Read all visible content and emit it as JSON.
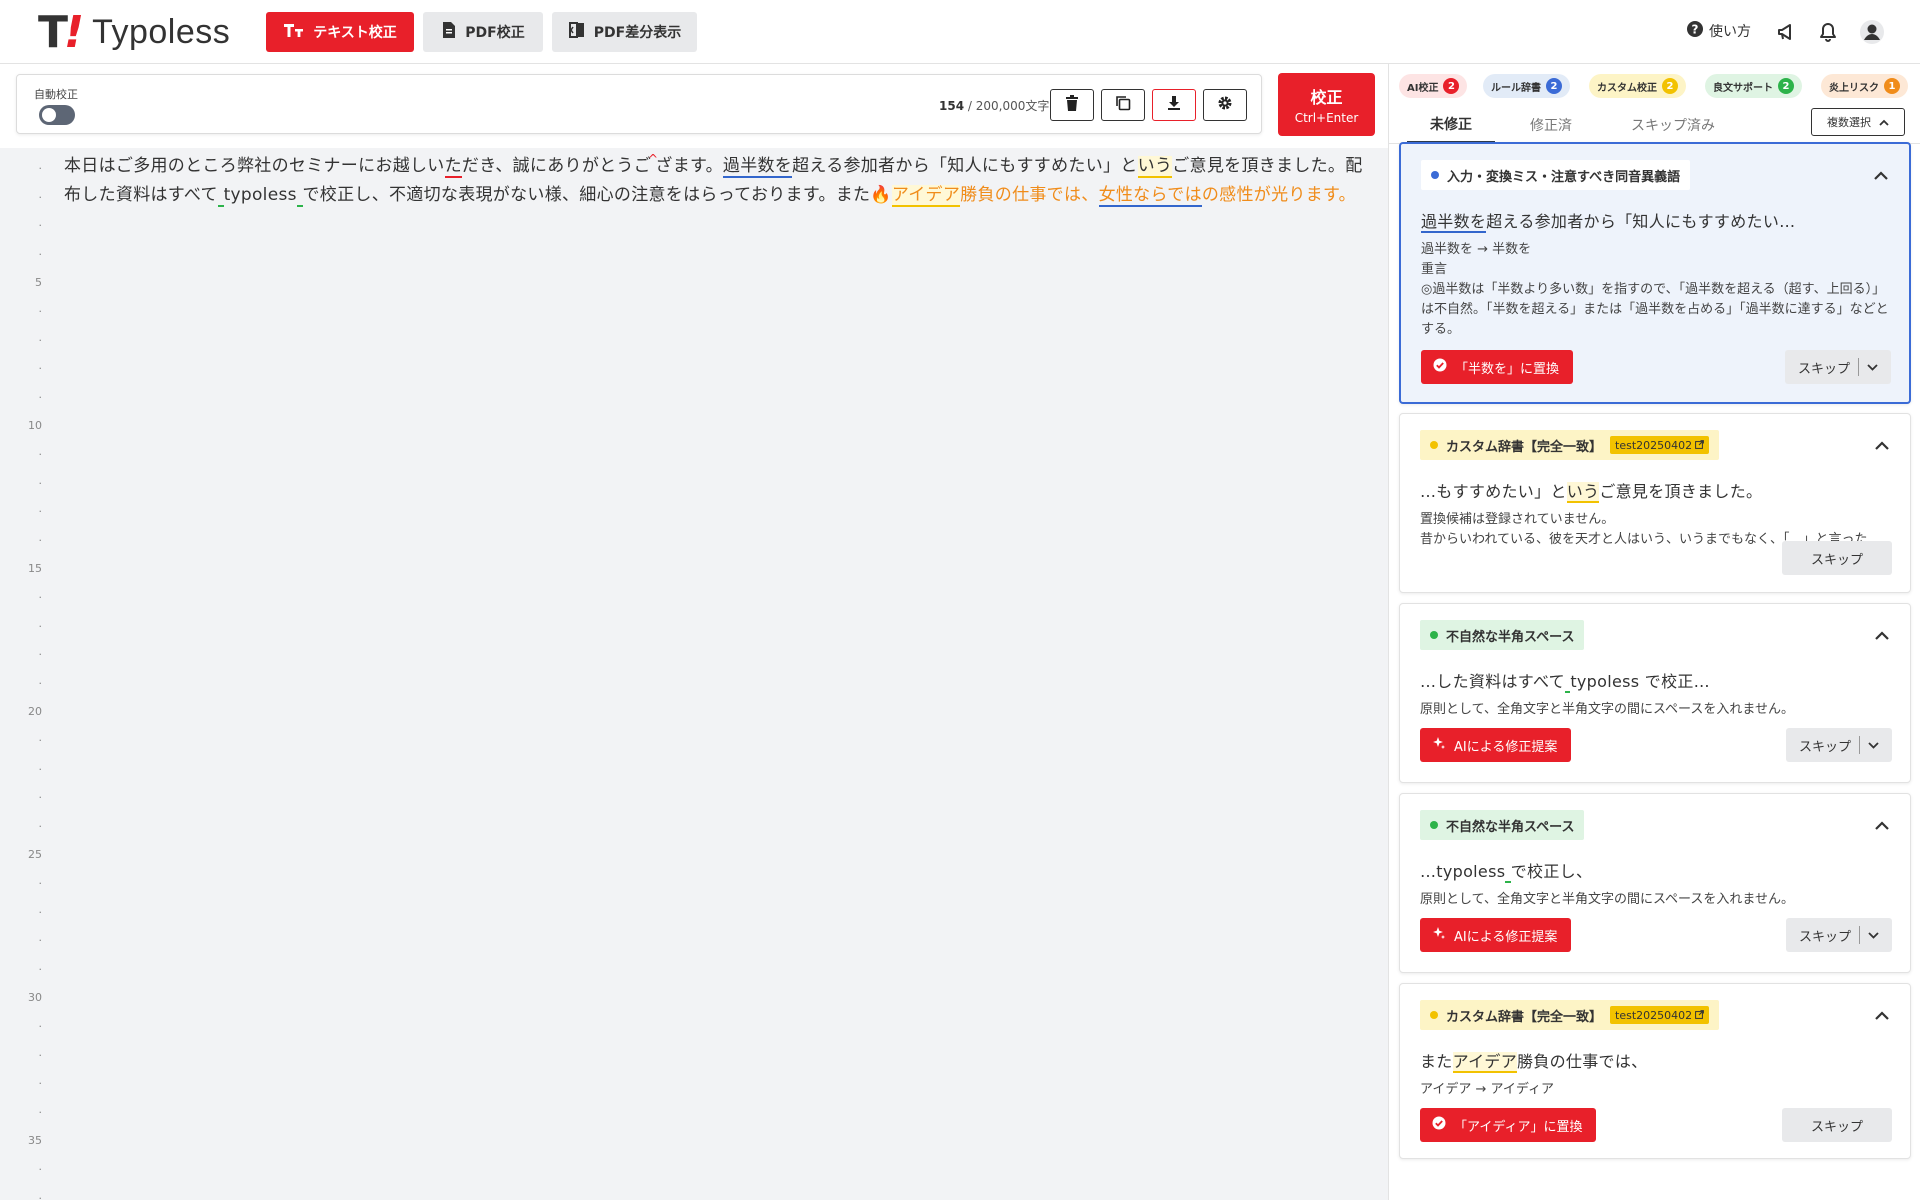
{
  "header": {
    "logo_mark": "T",
    "logo_bang": "!",
    "logo_text": "Typoless",
    "nav": [
      {
        "label": "テキスト校正"
      },
      {
        "label": "PDF校正"
      },
      {
        "label": "PDF差分表示"
      }
    ],
    "help_label": "使い方",
    "icons": [
      "help-circle-icon",
      "megaphone-icon",
      "bell-icon",
      "user-avatar-icon"
    ]
  },
  "toolbar": {
    "auto_label": "自動校正",
    "auto_enabled": false,
    "char_count": "154",
    "char_sep": " / ",
    "char_limit": "200,000文字",
    "run_label": "校正",
    "run_shortcut": "Ctrl+Enter"
  },
  "editor": {
    "line_numbers": [
      "5",
      "10",
      "15",
      "20",
      "25",
      "30",
      "35"
    ],
    "segments": [
      {
        "t": "本日はご多用のところ弊社のセミナーにお越しい"
      },
      {
        "t": "た",
        "c": "u-red"
      },
      {
        "t": "だき、誠にありがとうご"
      },
      {
        "t": "ざ",
        "caret": true
      },
      {
        "t": "ます。"
      },
      {
        "t": "過半数を",
        "c": "u-blue"
      },
      {
        "t": "超える参加者から「知人にもすすめたい」と"
      },
      {
        "t": "いう",
        "c": "u-yel"
      },
      {
        "t": "ご意見を頂きました。配布した資料はすべて"
      },
      {
        "t": " ",
        "c": "u-grn"
      },
      {
        "t": "typoless"
      },
      {
        "t": " ",
        "c": "u-grn"
      },
      {
        "t": "で校正し、不適切な表現がない様、細心の注意をはらっております。また"
      },
      {
        "t": "🔥",
        "c": "orange"
      },
      {
        "t": "アイデア",
        "c": "orange u-yel"
      },
      {
        "t": "勝負の仕事では、",
        "c": "orange"
      },
      {
        "t": "女性ならでは",
        "c": "orange u-blue"
      },
      {
        "t": "の感性が光ります。",
        "c": "orange"
      }
    ]
  },
  "panel": {
    "categories": [
      {
        "label": "AI校正",
        "count": "2",
        "bg": "#fde4e4",
        "badge": "#e8202a"
      },
      {
        "label": "ルール辞書",
        "count": "2",
        "bg": "#e2ebf7",
        "badge": "#3b6bd6"
      },
      {
        "label": "カスタム校正",
        "count": "2",
        "bg": "#fdf4c6",
        "badge": "#f2c200"
      },
      {
        "label": "良文サポート",
        "count": "2",
        "bg": "#dff4e3",
        "badge": "#2db34a"
      },
      {
        "label": "炎上リスク",
        "count": "1",
        "bg": "#fde8d6",
        "badge": "#f08c1a"
      }
    ],
    "tabs": [
      "未修正",
      "修正済",
      "スキップ済み"
    ],
    "multi_select": "複数選択",
    "cards": [
      {
        "tag": "入力・変換ミス・注意すべき同音異義語",
        "tag_bg": "#ffffff",
        "dot": "#3b6bd6",
        "text_pre": "",
        "text_hl": "過半数を",
        "text_post": "超える参加者から「知人にもすすめたい…",
        "desc": [
          "過半数を → 半数を",
          "重言",
          "◎過半数は「半数より多い数」を指すので、「過半数を超える（超す、上回る）」は不自然。「半数を超える」または「過半数を占める」「過半数に達する」などとする。"
        ],
        "fix_label": "「半数を」に置換",
        "skip_label": "スキップ"
      },
      {
        "tag": "カスタム辞書【完全一致】",
        "tag_bg": "#fdf4c6",
        "dot": "#f2c200",
        "dict": "test20250402",
        "text_pre": "…もすすめたい」と",
        "text_hl": "いう",
        "text_post": "ご意見を頂きました。",
        "desc": [
          "置換候補は登録されていません。",
          "昔からいわれている、彼を天才と人はいう、いうまでもなく、「　」と言った"
        ],
        "skip_label": "スキップ"
      },
      {
        "tag": "不自然な半角スペース",
        "tag_bg": "#dff4e3",
        "dot": "#2db34a",
        "text_pre": "…した資料はすべて",
        "text_hl": " ",
        "text_post": "typoless で校正…",
        "desc": [
          "原則として、全角文字と半角文字の間にスペースを入れません。"
        ],
        "fix_label": "AIによる修正提案",
        "skip_label": "スキップ"
      },
      {
        "tag": "不自然な半角スペース",
        "tag_bg": "#dff4e3",
        "dot": "#2db34a",
        "text_pre": "…typoless",
        "text_hl": " ",
        "text_post": "で校正し、",
        "desc": [
          "原則として、全角文字と半角文字の間にスペースを入れません。"
        ],
        "fix_label": "AIによる修正提案",
        "skip_label": "スキップ"
      },
      {
        "tag": "カスタム辞書【完全一致】",
        "tag_bg": "#fdf4c6",
        "dot": "#f2c200",
        "dict": "test20250402",
        "text_pre": "また",
        "text_hl": "アイデア",
        "text_post": "勝負の仕事では、",
        "desc": [
          "アイデア → アイディア"
        ],
        "fix_label": "「アイディア」に置換",
        "skip_label": "スキップ"
      }
    ]
  }
}
